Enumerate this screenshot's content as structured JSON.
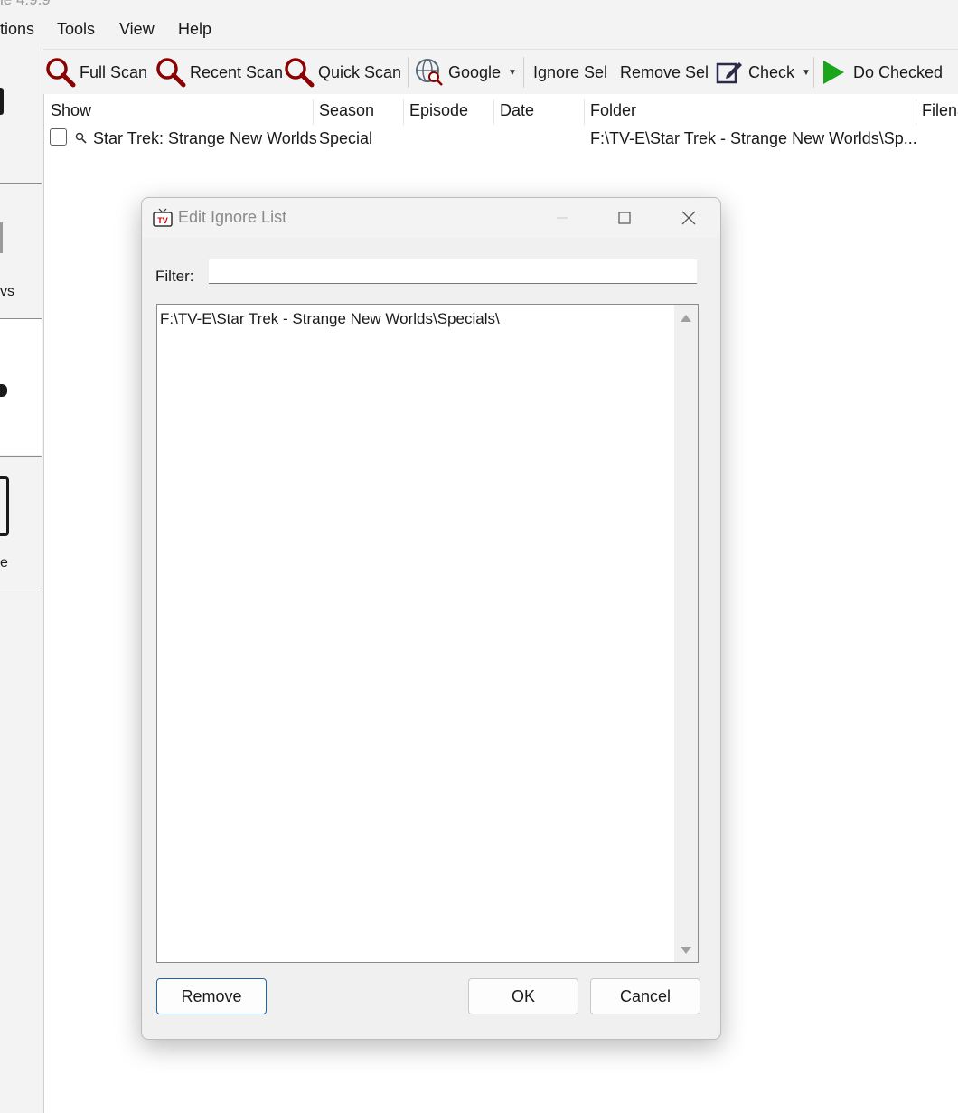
{
  "window": {
    "title_fragment": "le 4.9.9"
  },
  "menu": [
    "tions",
    "Tools",
    "View",
    "Help"
  ],
  "left_pane": {
    "labels": [
      "vs",
      "e"
    ]
  },
  "toolbar": {
    "full_scan": "Full Scan",
    "recent_scan": "Recent Scan",
    "quick_scan": "Quick Scan",
    "google": "Google",
    "ignore_sel": "Ignore Sel",
    "remove_sel": "Remove Sel",
    "check": "Check",
    "do_checked": "Do Checked"
  },
  "list": {
    "columns": [
      "Show",
      "Season",
      "Episode",
      "Date",
      "Folder",
      "Filena"
    ],
    "rows": [
      {
        "show": "Star Trek: Strange New Worlds",
        "season": "Special",
        "episode": "",
        "date": "",
        "folder": "F:\\TV-E\\Star Trek - Strange New Worlds\\Sp...",
        "filename": ""
      }
    ]
  },
  "dialog": {
    "title": "Edit Ignore List",
    "filter_label": "Filter:",
    "filter_value": "",
    "items": [
      "F:\\TV-E\\Star Trek - Strange New Worlds\\Specials\\"
    ],
    "remove_label": "Remove",
    "ok_label": "OK",
    "cancel_label": "Cancel"
  },
  "colors": {
    "scan_icon": "#8b0000",
    "do_checked_icon": "#1aa51a",
    "default_button_border": "#2563a8"
  }
}
